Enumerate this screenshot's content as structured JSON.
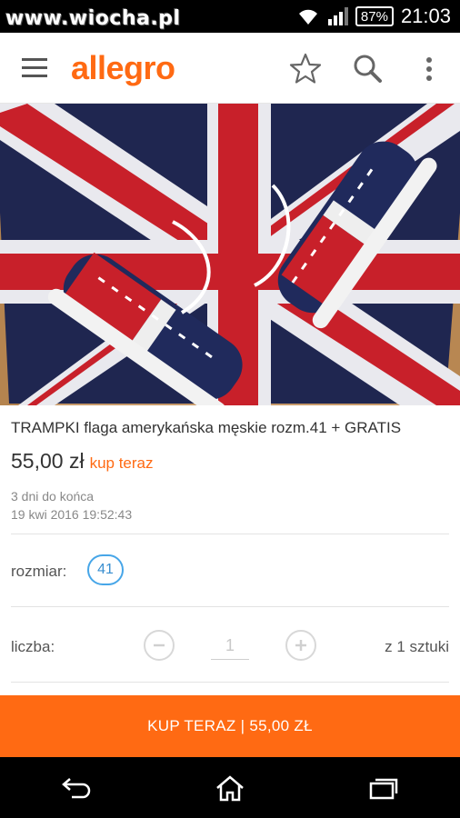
{
  "status_bar": {
    "watermark": "www.wiocha.pl",
    "battery": "87%",
    "time": "21:03"
  },
  "app_bar": {
    "logo": "allegro",
    "icons": [
      "menu-icon",
      "star-icon",
      "search-icon",
      "more-vert-icon"
    ]
  },
  "product": {
    "title": "TRAMPKI flaga amerykańska męskie rozm.41 + GRATIS",
    "price": "55,00 zł",
    "buy_now_link": "kup teraz",
    "time_left": "3 dni do końca",
    "end_date": "19 kwi 2016 19:52:43"
  },
  "options": {
    "size_label": "rozmiar:",
    "size_value": "41",
    "quantity_label": "liczba:",
    "quantity_value": "1",
    "stock_text": "z 1 sztuki"
  },
  "buy_button": {
    "label": "KUP TERAZ | 55,00 ZŁ"
  },
  "colors": {
    "accent": "#ff6a13",
    "chip_blue": "#47a6e8"
  }
}
